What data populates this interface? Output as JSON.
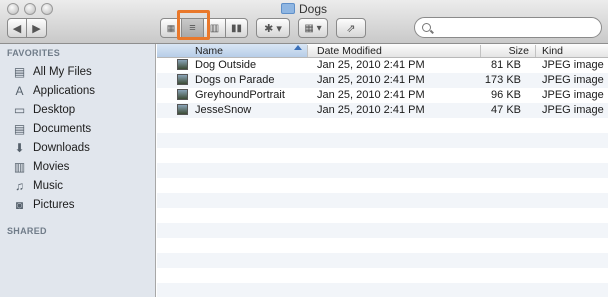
{
  "window": {
    "title": "Dogs"
  },
  "toolbar": {
    "back_icon": "back-arrow-icon",
    "forward_icon": "forward-arrow-icon",
    "views": [
      "icon-view",
      "list-view",
      "column-view",
      "coverflow-view"
    ],
    "active_view": "list-view",
    "action_icon": "gear-icon",
    "arrange_icon": "arrange-grid-icon",
    "share_icon": "share-icon",
    "search_placeholder": ""
  },
  "sidebar": {
    "favorites_header": "FAVORITES",
    "items": [
      {
        "label": "All My Files",
        "icon": "all-files-icon"
      },
      {
        "label": "Applications",
        "icon": "applications-icon"
      },
      {
        "label": "Desktop",
        "icon": "desktop-icon"
      },
      {
        "label": "Documents",
        "icon": "documents-icon"
      },
      {
        "label": "Downloads",
        "icon": "downloads-icon"
      },
      {
        "label": "Movies",
        "icon": "movies-icon"
      },
      {
        "label": "Music",
        "icon": "music-icon"
      },
      {
        "label": "Pictures",
        "icon": "pictures-icon"
      }
    ],
    "shared_header": "SHARED"
  },
  "list": {
    "columns": {
      "name": "Name",
      "date": "Date Modified",
      "size": "Size",
      "kind": "Kind"
    },
    "sort_column": "Name",
    "rows": [
      {
        "name": "Dog Outside",
        "date": "Jan 25, 2010 2:41 PM",
        "size": "81 KB",
        "kind": "JPEG image"
      },
      {
        "name": "Dogs on Parade",
        "date": "Jan 25, 2010 2:41 PM",
        "size": "173 KB",
        "kind": "JPEG image"
      },
      {
        "name": "GreyhoundPortrait",
        "date": "Jan 25, 2010 2:41 PM",
        "size": "96 KB",
        "kind": "JPEG image"
      },
      {
        "name": "JesseSnow",
        "date": "Jan 25, 2010 2:41 PM",
        "size": "47 KB",
        "kind": "JPEG image"
      }
    ]
  },
  "colors": {
    "highlight_box": "#e9782b",
    "sidebar_bg": "#e1e6ed",
    "alt_row": "#f2f5f9"
  }
}
